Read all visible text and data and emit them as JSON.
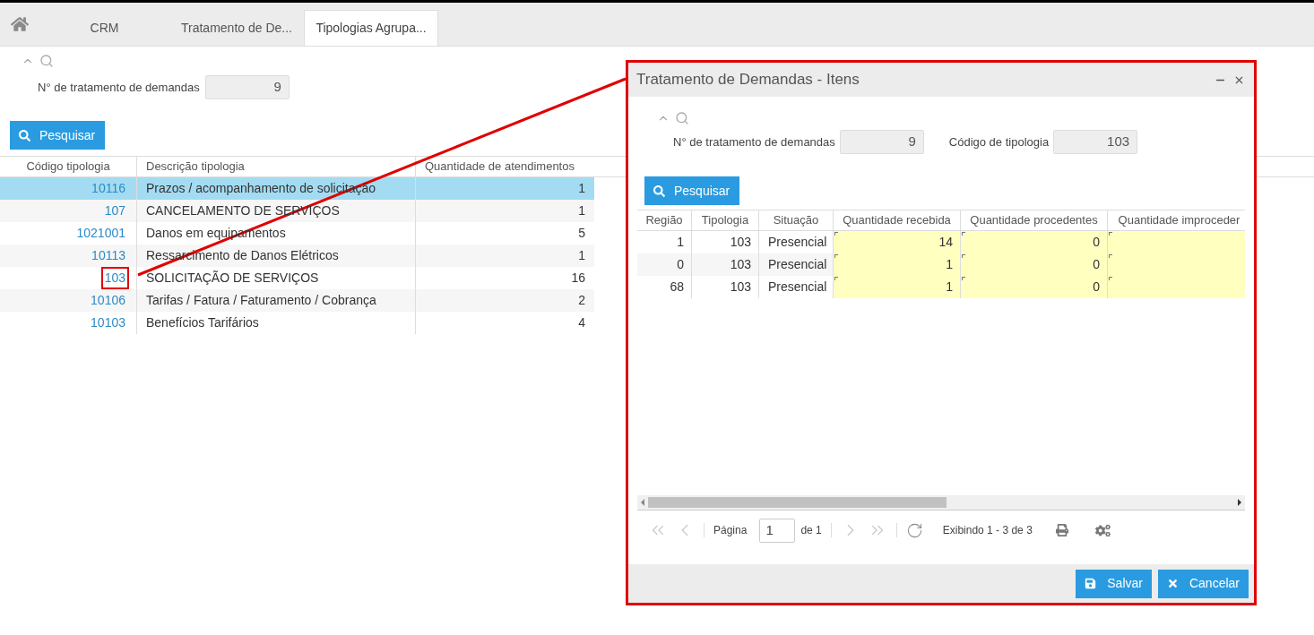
{
  "tabs": [
    {
      "label": "CRM",
      "selected": false
    },
    {
      "label": "Tratamento de De...",
      "selected": false
    },
    {
      "label": "Tipologias Agrupa...",
      "selected": true
    }
  ],
  "filter": {
    "label": "N° de tratamento de demandas",
    "value": "9"
  },
  "search_button": "Pesquisar",
  "table": {
    "columns": [
      "Código tipologia",
      "Descrição tipologia",
      "Quantidade de atendimentos"
    ],
    "rows": [
      {
        "code": "10116",
        "description": "Prazos / acompanhamento de solicitação",
        "count": "1",
        "selected": true,
        "highlighted": false
      },
      {
        "code": "107",
        "description": "CANCELAMENTO DE SERVIÇOS",
        "count": "1",
        "selected": false,
        "highlighted": false
      },
      {
        "code": "1021001",
        "description": "Danos em equipamentos",
        "count": "5",
        "selected": false,
        "highlighted": false
      },
      {
        "code": "10113",
        "description": "Ressarcimento de Danos Elétricos",
        "count": "1",
        "selected": false,
        "highlighted": false
      },
      {
        "code": "103",
        "description": "SOLICITAÇÃO DE SERVIÇOS",
        "count": "16",
        "selected": false,
        "highlighted": true
      },
      {
        "code": "10106",
        "description": "Tarifas / Fatura / Faturamento / Cobrança",
        "count": "2",
        "selected": false,
        "highlighted": false
      },
      {
        "code": "10103",
        "description": "Benefícios Tarifários",
        "count": "4",
        "selected": false,
        "highlighted": false
      }
    ]
  },
  "dialog": {
    "title": "Tratamento de Demandas - Itens",
    "highlighted": true,
    "fields": [
      {
        "label": "N° de tratamento de demandas",
        "value": "9"
      },
      {
        "label": "Código de tipologia",
        "value": "103"
      }
    ],
    "search_button": "Pesquisar",
    "columns": [
      {
        "label": "Região",
        "editable": false
      },
      {
        "label": "Tipologia",
        "editable": false
      },
      {
        "label": "Situação",
        "editable": false
      },
      {
        "label": "Quantidade recebida",
        "editable": true
      },
      {
        "label": "Quantidade procedentes",
        "editable": true
      },
      {
        "label": "Quantidade improceder",
        "editable": true
      }
    ],
    "rows": [
      [
        "1",
        "103",
        "Presencial",
        "14",
        "0",
        ""
      ],
      [
        "0",
        "103",
        "Presencial",
        "1",
        "0",
        ""
      ],
      [
        "68",
        "103",
        "Presencial",
        "1",
        "0",
        ""
      ]
    ],
    "pager": {
      "nav_disabled": true,
      "page_label": "Página",
      "page": "1",
      "of": "de 1",
      "summary": "Exibindo 1 - 3 de 3"
    },
    "buttons": [
      {
        "label": "Salvar",
        "kind": "save"
      },
      {
        "label": "Cancelar",
        "kind": "cancel"
      }
    ]
  }
}
